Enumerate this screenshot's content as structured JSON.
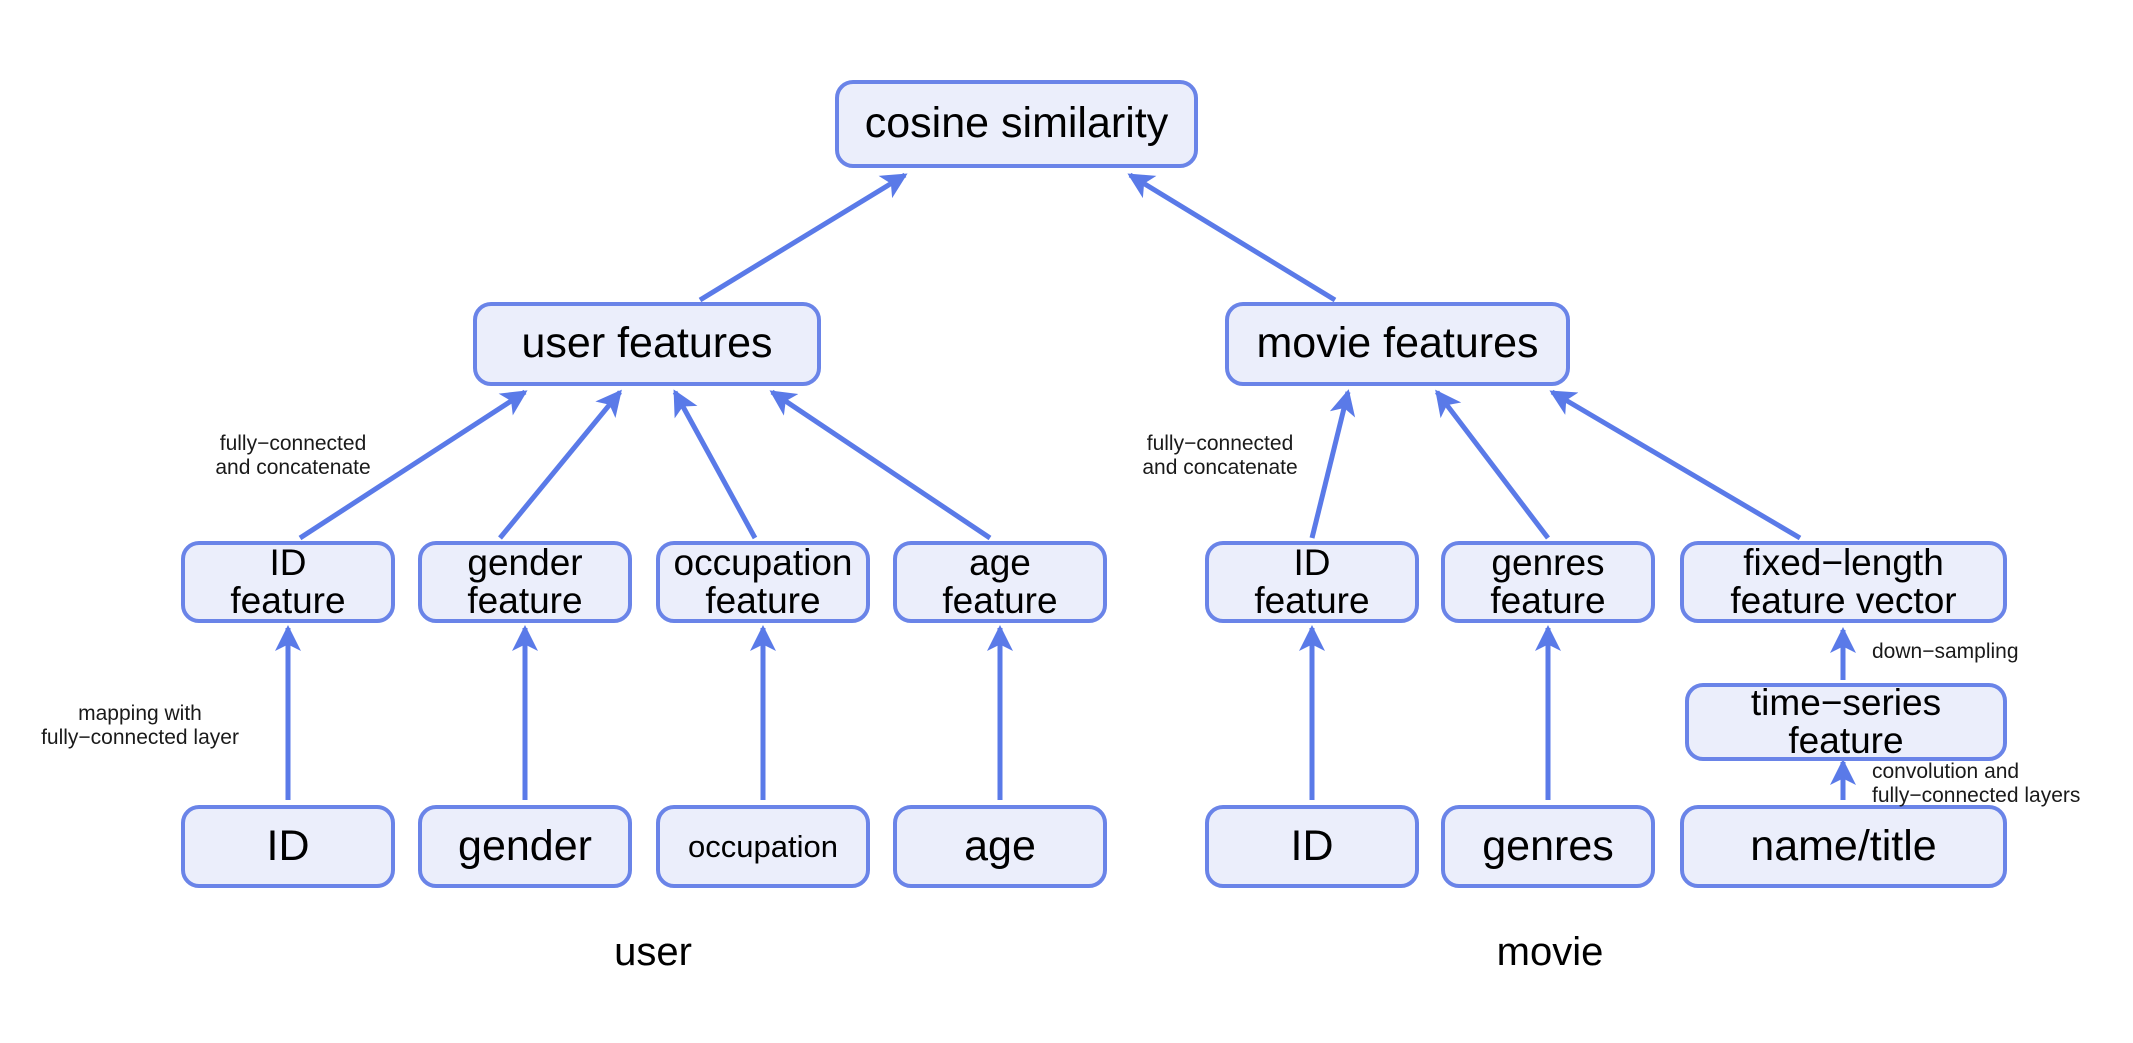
{
  "diagram": {
    "title_text": "cosine similarity",
    "accent_border": "#6a84e8",
    "node_fill": "#ebeefb",
    "nodes": {
      "cosine_similarity": "cosine similarity",
      "user_features": "user features",
      "movie_features": "movie features",
      "user_id_feature": "ID\nfeature",
      "user_gender_feature": "gender\nfeature",
      "user_occupation_feature": "occupation\nfeature",
      "user_age_feature": "age\nfeature",
      "movie_id_feature": "ID\nfeature",
      "movie_genres_feature": "genres\nfeature",
      "fixed_length_feature_vector": "fixed−length\nfeature vector",
      "time_series_feature": "time−series\nfeature",
      "user_id_input": "ID",
      "user_gender_input": "gender",
      "user_occupation_input": "occupation",
      "user_age_input": "age",
      "movie_id_input": "ID",
      "movie_genres_input": "genres",
      "movie_name_title_input": "name/title"
    },
    "annotations": {
      "user_concat": "fully−connected\nand concatenate",
      "movie_concat": "fully−connected\nand concatenate",
      "mapping": "mapping with\nfully−connected layer",
      "down_sampling": "down−sampling",
      "convolution": "convolution and\nfully−connected layers"
    },
    "group_labels": {
      "user": "user",
      "movie": "movie"
    }
  }
}
